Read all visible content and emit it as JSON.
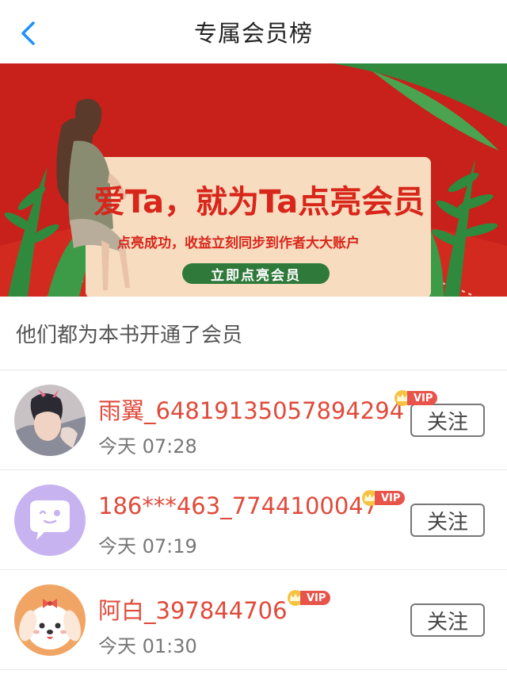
{
  "header": {
    "title": "专属会员榜"
  },
  "banner": {
    "headline": "爱Ta，就为Ta点亮会员",
    "subline": "点亮成功，收益立刻同步到作者大大账户",
    "cta": "立即点亮会员",
    "colors": {
      "background": "#c8201a",
      "card": "#f7dcc0",
      "cta": "#2f7a3a",
      "text": "#d8261b"
    }
  },
  "section": {
    "title": "他们都为本书开通了会员"
  },
  "members": [
    {
      "name": "雨翼_64819135057894294",
      "time": "今天 07:28",
      "vip": "VIP",
      "follow": "关注",
      "avatar": "photo-avatar"
    },
    {
      "name": "186***463_7744100047",
      "time": "今天 07:19",
      "vip": "VIP",
      "follow": "关注",
      "avatar": "chat-bubble-avatar"
    },
    {
      "name": "阿白_397844706",
      "time": "今天 01:30",
      "vip": "VIP",
      "follow": "关注",
      "avatar": "puppy-avatar"
    }
  ],
  "theme": {
    "accent": "#e04a3a",
    "vip": "#e8544a",
    "back_arrow": "#1e90ff"
  }
}
